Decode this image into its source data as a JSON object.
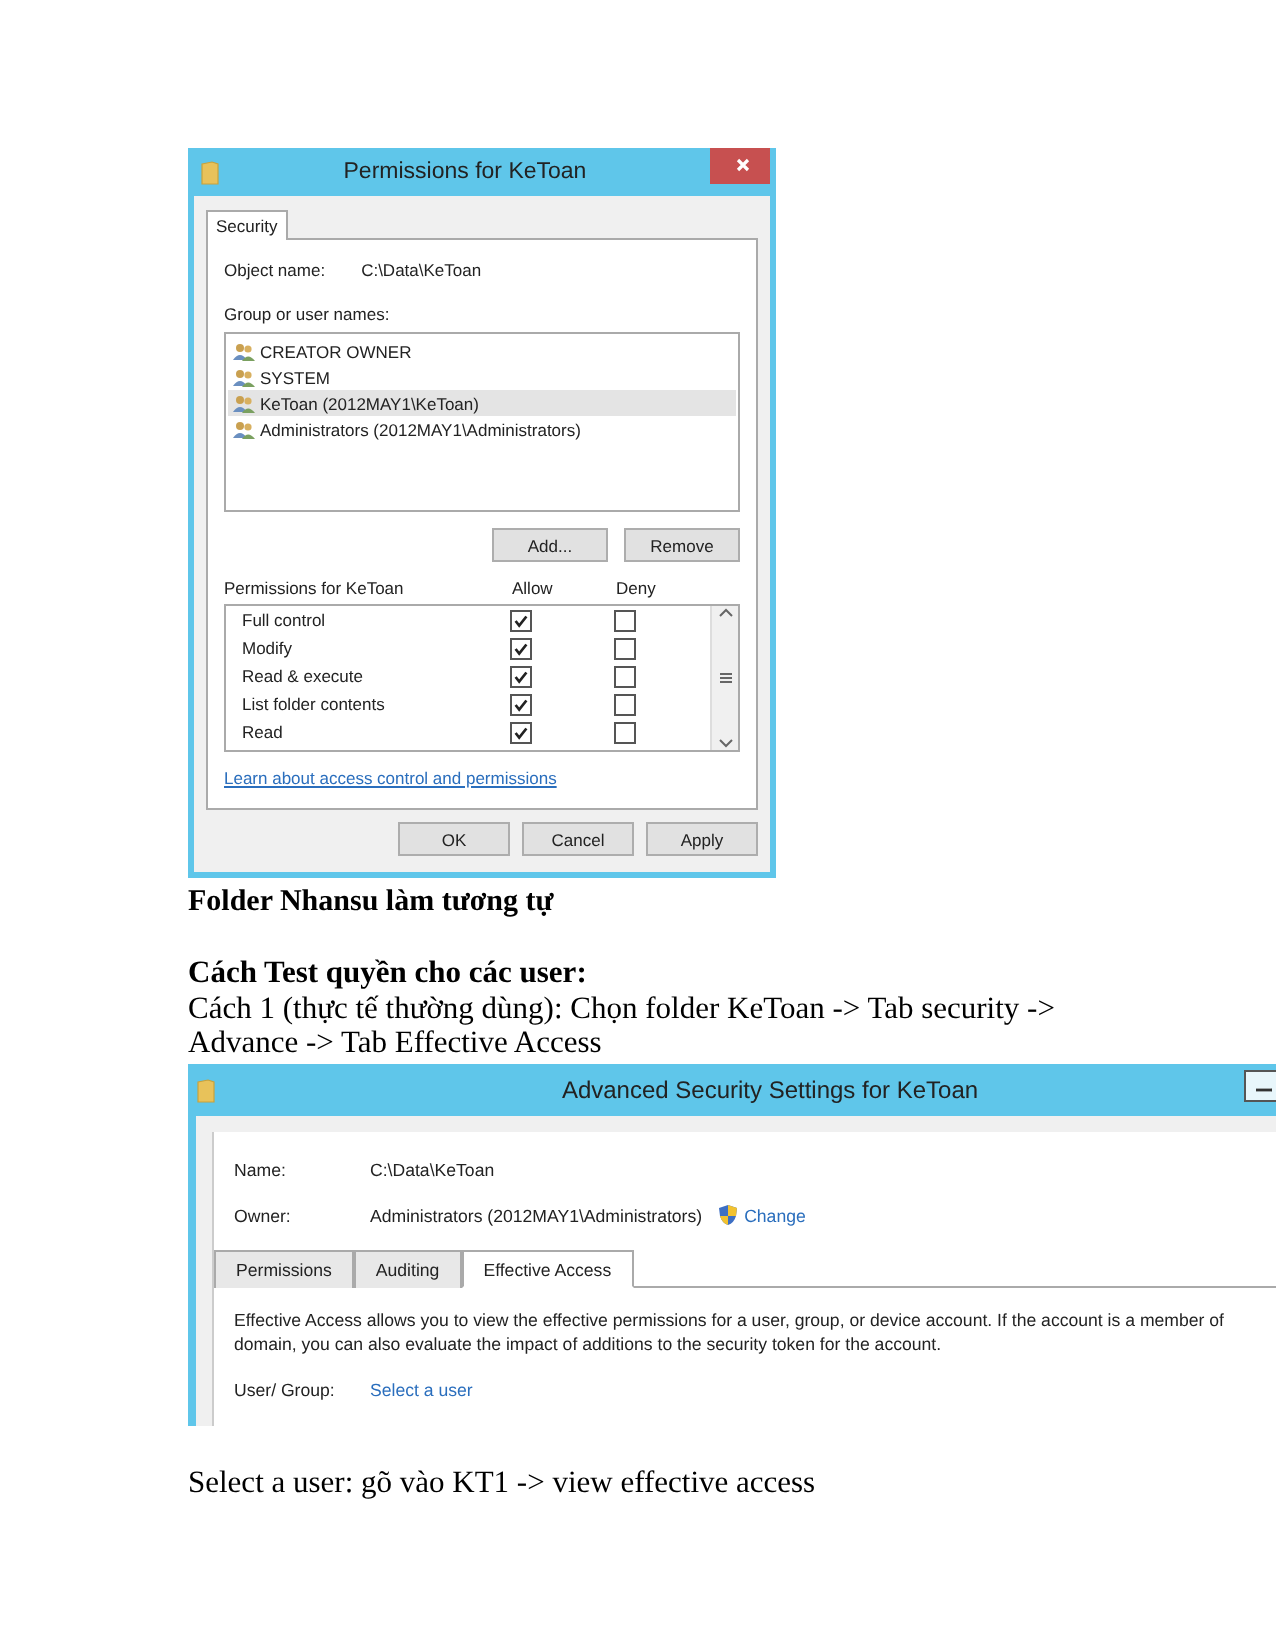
{
  "dialog": {
    "title": "Permissions for KeToan",
    "tabs": [
      {
        "label": "Security",
        "selected": true
      }
    ],
    "object_name_label": "Object name:",
    "object_name": "C:\\Data\\KeToan",
    "group_label": "Group or user names:",
    "users": [
      {
        "name": "CREATOR OWNER",
        "selected": false
      },
      {
        "name": "SYSTEM",
        "selected": false
      },
      {
        "name": "KeToan (2012MAY1\\KeToan)",
        "selected": true
      },
      {
        "name": "Administrators (2012MAY1\\Administrators)",
        "selected": false
      }
    ],
    "user_buttons": [
      "Add...",
      "Remove"
    ],
    "perm_label": "Permissions for KeToan",
    "allow_label": "Allow",
    "deny_label": "Deny",
    "permissions": [
      {
        "name": "Full control",
        "allow": true,
        "deny": false
      },
      {
        "name": "Modify",
        "allow": true,
        "deny": false
      },
      {
        "name": "Read & execute",
        "allow": true,
        "deny": false
      },
      {
        "name": "List folder contents",
        "allow": true,
        "deny": false
      },
      {
        "name": "Read",
        "allow": true,
        "deny": false
      }
    ],
    "link": "Learn about access control and permissions",
    "buttons": [
      "OK",
      "Cancel",
      "Apply"
    ]
  },
  "note": "Folder Nhansu làm tương tự",
  "heading": "Cách Test quyền cho các user:",
  "instructions": [
    "Cách 1 (thực tế thường dùng): Chọn folder KeToan -> Tab security ->",
    "Advance -> Tab Effective Access"
  ],
  "advanced_window": {
    "title": "Advanced Security Settings for KeToan",
    "name_label": "Name:",
    "name": "C:\\Data\\KeToan",
    "owner_label": "Owner:",
    "owner": "Administrators (2012MAY1\\Administrators)",
    "change_link": "Change",
    "tabs": [
      {
        "label": "Permissions",
        "selected": false
      },
      {
        "label": "Auditing",
        "selected": false
      },
      {
        "label": "Effective Access",
        "selected": true
      }
    ],
    "description": [
      "Effective Access allows you to view the effective permissions for a user, group, or device account. If the account is a member of",
      "domain, you can also evaluate the impact of additions to the security token for the account."
    ],
    "user_group_label": "User/ Group:",
    "select_link": "Select a user"
  },
  "footer": "Select a user: gõ vào KT1 -> view effective access"
}
